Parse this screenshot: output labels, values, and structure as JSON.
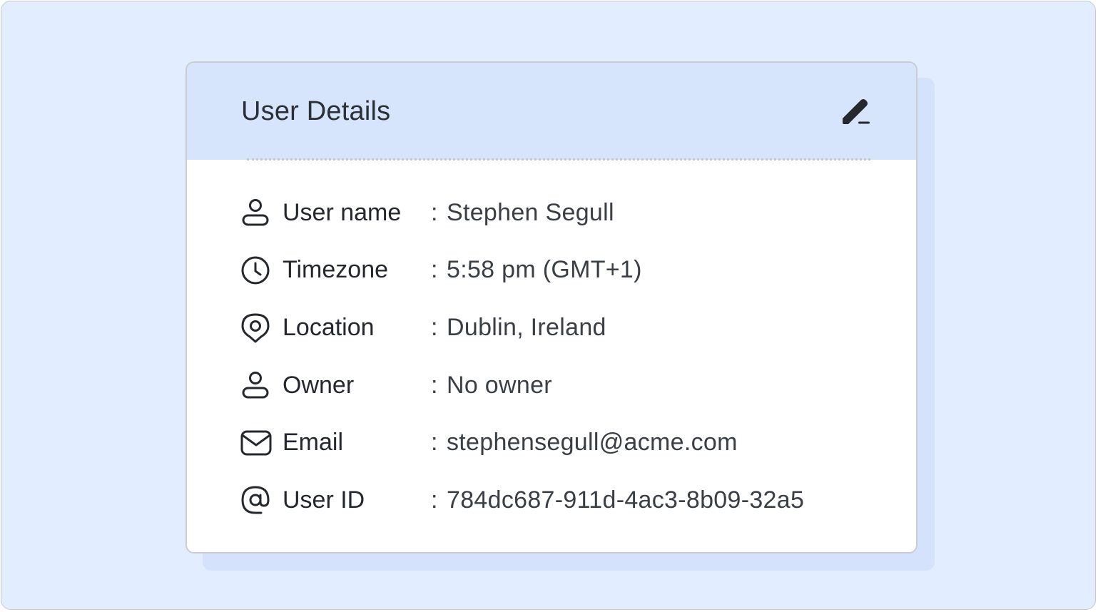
{
  "card": {
    "title": "User Details",
    "edit_icon": "pencil-icon"
  },
  "rows": [
    {
      "icon": "user-icon",
      "label": "User name",
      "separator": ":",
      "value": "Stephen Segull"
    },
    {
      "icon": "clock-icon",
      "label": "Timezone",
      "separator": ":",
      "value": "5:58 pm (GMT+1)"
    },
    {
      "icon": "location-pin-icon",
      "label": "Location",
      "separator": ":",
      "value": "Dublin, Ireland"
    },
    {
      "icon": "user-icon",
      "label": "Owner",
      "separator": ":",
      "value": "No owner"
    },
    {
      "icon": "envelope-icon",
      "label": "Email",
      "separator": ":",
      "value": "stephensegull@acme.com"
    },
    {
      "icon": "at-sign-icon",
      "label": "User ID",
      "separator": ":",
      "value": "784dc687-911d-4ac3-8b09-32a5"
    }
  ],
  "colors": {
    "background": "#e2eeff",
    "header": "#d6e5fc",
    "shadow": "#d4e3fb",
    "text": "#24272d"
  }
}
